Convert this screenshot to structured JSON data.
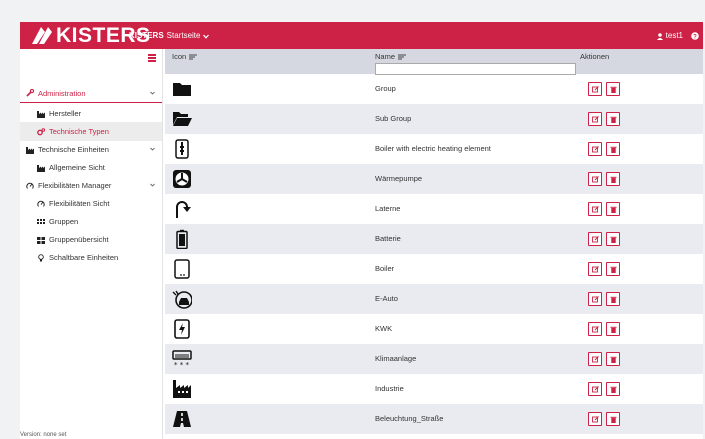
{
  "header": {
    "logo_text": "KISTERS",
    "brand": "KISTERS",
    "page_menu": "Startseite",
    "user": "test1",
    "accent": "#cd2145"
  },
  "sidebar": {
    "items": [
      {
        "label": "Administration",
        "icon": "wrench-icon",
        "level": "top",
        "state": "expanded-selected"
      },
      {
        "label": "Hersteller",
        "icon": "factory-icon",
        "level": "sub",
        "state": ""
      },
      {
        "label": "Technische Typen",
        "icon": "gears-icon",
        "level": "sub",
        "state": "active"
      },
      {
        "label": "Technische Einheiten",
        "icon": "factory-icon",
        "level": "top",
        "state": "collapsible"
      },
      {
        "label": "Allgemeine Sicht",
        "icon": "factory-icon",
        "level": "sub",
        "state": ""
      },
      {
        "label": "Flexibilitäten Manager",
        "icon": "dial-icon",
        "level": "top",
        "state": "collapsible"
      },
      {
        "label": "Flexibilitäten Sicht",
        "icon": "dial-icon",
        "level": "sub",
        "state": ""
      },
      {
        "label": "Gruppen",
        "icon": "grid-icon",
        "level": "sub",
        "state": ""
      },
      {
        "label": "Gruppenübersicht",
        "icon": "blocks-icon",
        "level": "sub",
        "state": ""
      },
      {
        "label": "Schaltbare Einheiten",
        "icon": "bulb-icon",
        "level": "sub",
        "state": ""
      }
    ],
    "version": "Version: none set"
  },
  "table": {
    "columns": {
      "icon": "Icon",
      "name": "Name",
      "actions": "Aktionen"
    },
    "name_filter_value": "",
    "rows": [
      {
        "icon": "folder-icon",
        "name": "Group"
      },
      {
        "icon": "folder-open-icon",
        "name": "Sub Group"
      },
      {
        "icon": "boiler-heating-element-icon",
        "name": "Boiler with electric heating element"
      },
      {
        "icon": "heat-pump-icon",
        "name": "Wärmepumpe"
      },
      {
        "icon": "street-lamp-icon",
        "name": "Laterne"
      },
      {
        "icon": "battery-icon",
        "name": "Batterie"
      },
      {
        "icon": "boiler-icon",
        "name": "Boiler"
      },
      {
        "icon": "electric-car-icon",
        "name": "E-Auto"
      },
      {
        "icon": "chp-icon",
        "name": "KWK"
      },
      {
        "icon": "air-conditioner-icon",
        "name": "Klimaanlage"
      },
      {
        "icon": "industry-icon",
        "name": "Industrie"
      },
      {
        "icon": "road-icon",
        "name": "Beleuchtung_Straße"
      }
    ]
  }
}
